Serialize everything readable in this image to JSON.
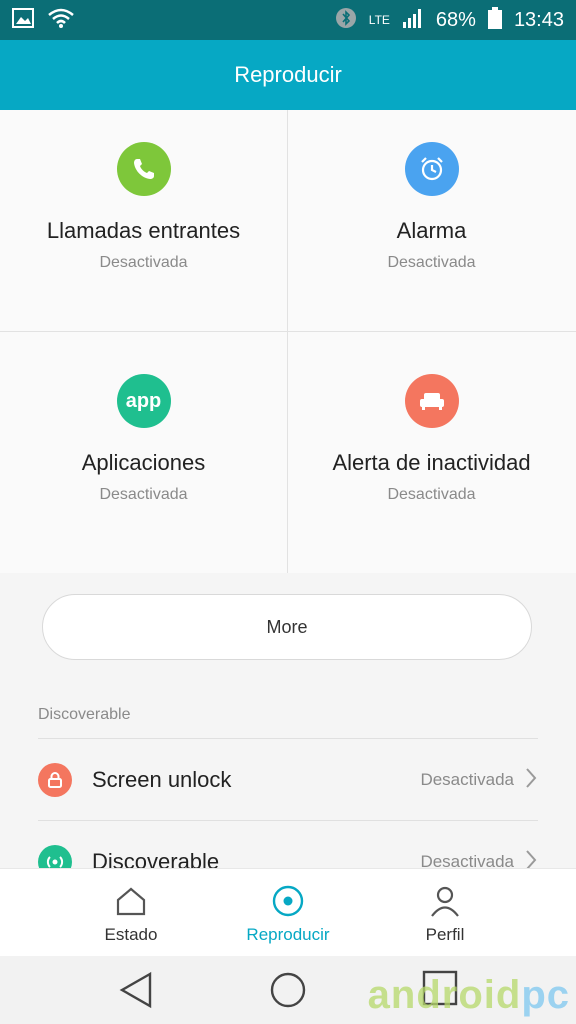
{
  "status_bar": {
    "network": "LTE",
    "battery": "68%",
    "time": "13:43",
    "icons": [
      "image-icon",
      "wifi-icon",
      "bluetooth-icon",
      "signal-icon",
      "battery-icon"
    ]
  },
  "app_bar": {
    "title": "Reproducir"
  },
  "tiles": [
    {
      "title": "Llamadas entrantes",
      "status": "Desactivada",
      "icon": "phone-icon",
      "color": "#7ec73a"
    },
    {
      "title": "Alarma",
      "status": "Desactivada",
      "icon": "alarm-clock-icon",
      "color": "#4aa3f0"
    },
    {
      "title": "Aplicaciones",
      "status": "Desactivada",
      "icon": "app-icon",
      "icon_text": "app",
      "color": "#1fbf8f"
    },
    {
      "title": "Alerta de inactividad",
      "status": "Desactivada",
      "icon": "sofa-icon",
      "color": "#f4765f"
    }
  ],
  "more_button": {
    "label": "More"
  },
  "discoverable_section": {
    "title": "Discoverable",
    "rows": [
      {
        "label": "Screen unlock",
        "status": "Desactivada",
        "icon": "lock-icon",
        "color": "#f4765f"
      },
      {
        "label": "Discoverable",
        "status": "Desactivada",
        "icon": "broadcast-icon",
        "color": "#1fbf8f"
      }
    ]
  },
  "bottom_nav": [
    {
      "label": "Estado",
      "icon": "home-icon",
      "active": false
    },
    {
      "label": "Reproducir",
      "icon": "play-circle-icon",
      "active": true
    },
    {
      "label": "Perfil",
      "icon": "person-icon",
      "active": false
    }
  ],
  "system_nav": [
    "back-icon",
    "home-circle-icon",
    "recents-icon"
  ],
  "watermark": {
    "part1": "android",
    "part2": "pc"
  },
  "colors": {
    "status_bar": "#0b6e76",
    "app_bar": "#06a8c4",
    "accent": "#06a8c4"
  }
}
